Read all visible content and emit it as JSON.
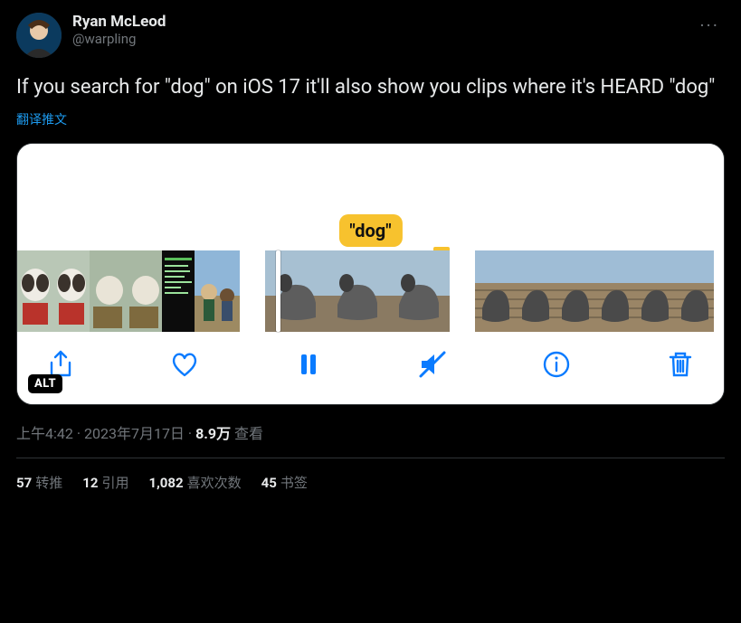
{
  "author": {
    "display_name": "Ryan McLeod",
    "handle": "@warpling"
  },
  "more_label": "···",
  "body": "If you search for \"dog\" on iOS 17 it'll also show you clips where it's HEARD \"dog\"",
  "translate": "翻译推文",
  "media": {
    "tag": "\"dog\"",
    "alt_badge": "ALT",
    "toolbar": {
      "share": "share",
      "like": "like",
      "pause": "pause",
      "mute": "mute",
      "info": "info",
      "delete": "delete"
    }
  },
  "meta": {
    "time": "上午4:42",
    "sep": " · ",
    "date": "2023年7月17日",
    "views_count": "8.9万",
    "views_label": " 查看"
  },
  "stats": {
    "retweet_count": "57",
    "retweet_label": "转推",
    "quote_count": "12",
    "quote_label": "引用",
    "like_count": "1,082",
    "like_label": "喜欢次数",
    "bookmark_count": "45",
    "bookmark_label": "书签"
  }
}
